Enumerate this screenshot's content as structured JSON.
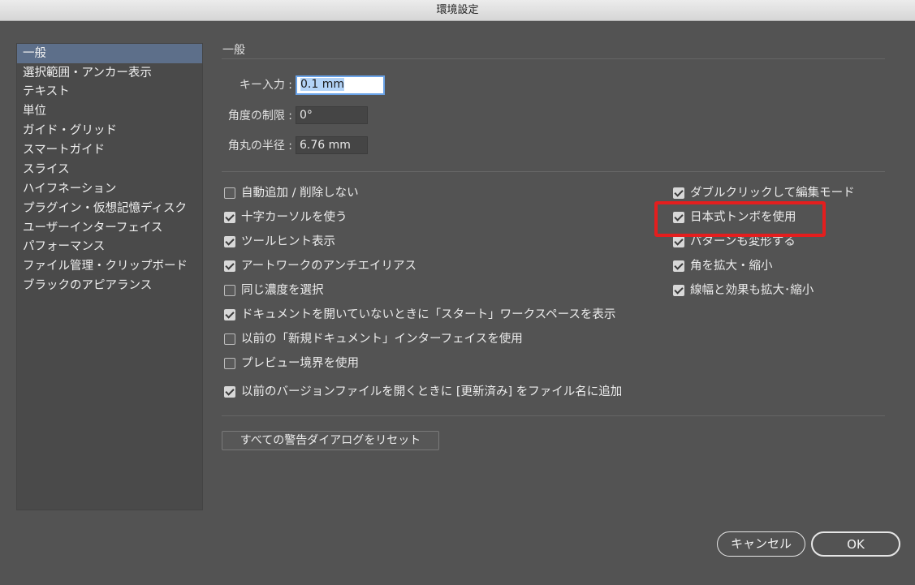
{
  "window": {
    "title": "環境設定"
  },
  "sidebar": {
    "items": [
      {
        "label": "一般",
        "active": true
      },
      {
        "label": "選択範囲・アンカー表示"
      },
      {
        "label": "テキスト"
      },
      {
        "label": "単位"
      },
      {
        "label": "ガイド・グリッド"
      },
      {
        "label": "スマートガイド"
      },
      {
        "label": "スライス"
      },
      {
        "label": "ハイフネーション"
      },
      {
        "label": "プラグイン・仮想記憶ディスク"
      },
      {
        "label": "ユーザーインターフェイス"
      },
      {
        "label": "パフォーマンス"
      },
      {
        "label": "ファイル管理・クリップボード"
      },
      {
        "label": "ブラックのアピアランス"
      }
    ]
  },
  "main": {
    "section_title": "一般",
    "fields": {
      "key_increment": {
        "label": "キー入力 :",
        "value": "0.1 mm"
      },
      "constrain_angle": {
        "label": "角度の制限 :",
        "value": "0°"
      },
      "corner_radius": {
        "label": "角丸の半径 :",
        "value": "6.76 mm"
      }
    },
    "left_options": [
      {
        "label": "自動追加 / 削除しない",
        "checked": false
      },
      {
        "label": "十字カーソルを使う",
        "checked": true
      },
      {
        "label": "ツールヒント表示",
        "checked": true
      },
      {
        "label": "アートワークのアンチエイリアス",
        "checked": true
      },
      {
        "label": "同じ濃度を選択",
        "checked": false
      },
      {
        "label": "ドキュメントを開いていないときに「スタート」ワークスペースを表示",
        "checked": true
      },
      {
        "label": "以前の「新規ドキュメント」インターフェイスを使用",
        "checked": false
      },
      {
        "label": "プレビュー境界を使用",
        "checked": false
      },
      {
        "label": "以前のバージョンファイルを開くときに [更新済み] をファイル名に追加",
        "checked": true
      }
    ],
    "right_options": [
      {
        "label": "ダブルクリックして編集モード",
        "checked": true
      },
      {
        "label": "日本式トンボを使用",
        "checked": true
      },
      {
        "label": "パターンも変形する",
        "checked": true
      },
      {
        "label": "角を拡大・縮小",
        "checked": true
      },
      {
        "label": "線幅と効果も拡大･縮小",
        "checked": true
      }
    ],
    "reset_button": "すべての警告ダイアログをリセット"
  },
  "footer": {
    "cancel_label": "キャンセル",
    "ok_label": "OK"
  },
  "colors": {
    "highlight": "#e41e1e",
    "selection": "#5d6f8a",
    "background": "#535353"
  }
}
